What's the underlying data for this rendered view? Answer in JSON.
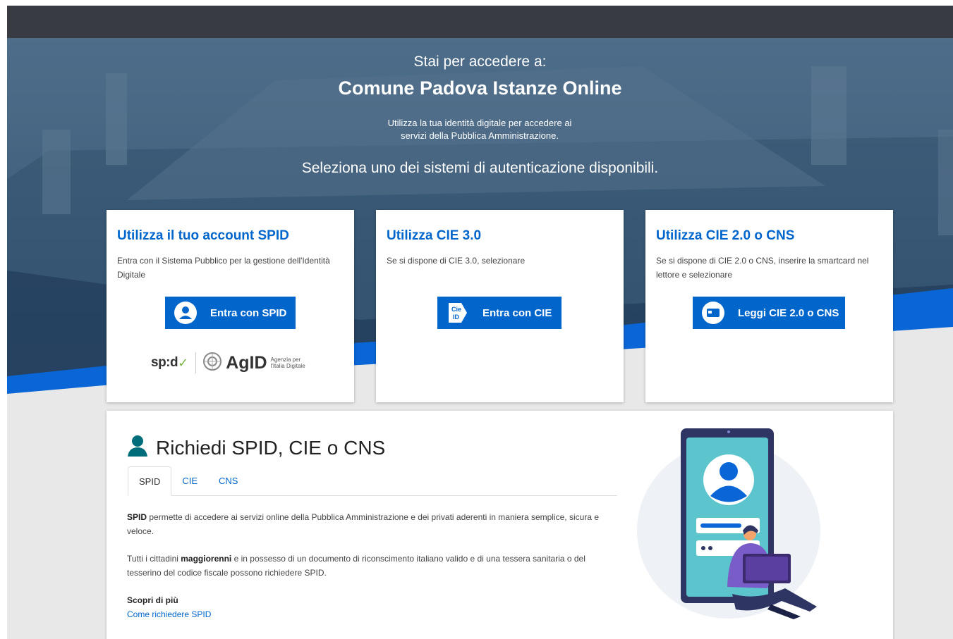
{
  "hero": {
    "pre_title": "Stai per accedere a:",
    "title": "Comune Padova Istanze Online",
    "subtitle": "Utilizza la tua identità digitale per accedere ai servizi della Pubblica Amministrazione.",
    "select_text": "Seleziona uno dei sistemi di autenticazione disponibili."
  },
  "cards": [
    {
      "title": "Utilizza il tuo account SPID",
      "description": "Entra con il Sistema Pubblico per la gestione dell'Identità Digitale",
      "button_label": "Entra con SPID",
      "button_icon": "user-circle-icon",
      "logos": {
        "spid": "sp:d",
        "agid": "AgID",
        "agid_sub": "Agenzia per l'Italia Digitale"
      }
    },
    {
      "title": "Utilizza CIE 3.0",
      "description": "Se si dispone di CIE 3.0, selezionare",
      "button_label": "Entra con CIE",
      "button_icon": "cie-id-icon",
      "icon_text": "Cie ID"
    },
    {
      "title": "Utilizza CIE 2.0 o CNS",
      "description": "Se si dispone di CIE 2.0 o CNS, inserire la smartcard nel lettore e selezionare",
      "button_label": "Leggi CIE 2.0 o CNS",
      "button_icon": "smartcard-icon"
    }
  ],
  "request_panel": {
    "title": "Richiedi SPID, CIE o CNS",
    "tabs": [
      {
        "label": "SPID",
        "active": true
      },
      {
        "label": "CIE",
        "active": false
      },
      {
        "label": "CNS",
        "active": false
      }
    ],
    "p1_bold": "SPID",
    "p1_rest": " permette di accedere ai servizi online della Pubblica Amministrazione e dei privati aderenti in maniera semplice, sicura e veloce.",
    "p2_start": "Tutti i cittadini ",
    "p2_bold": "maggiorenni",
    "p2_rest": " e in possesso di un documento di riconscimento italiano valido e di una tessera sanitaria o del tesserino del codice fiscale possono richiedere SPID.",
    "more_title": "Scopri di più",
    "more_link": "Come richiedere SPID"
  },
  "colors": {
    "primary": "#0066cc",
    "topbar": "#383c42",
    "teal_icon": "#006d7a"
  }
}
